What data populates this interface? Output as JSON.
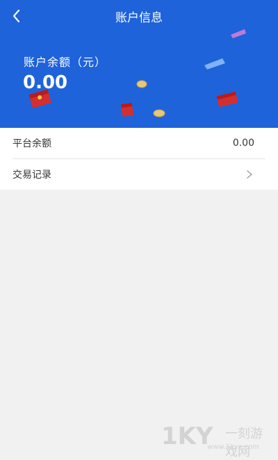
{
  "nav": {
    "title": "账户信息"
  },
  "balance": {
    "label": "账户余额（元）",
    "value": "0.00"
  },
  "list": [
    {
      "label": "平台余额",
      "value": "0.00"
    },
    {
      "label": "交易记录"
    }
  ],
  "watermark": {
    "mark": "1KY",
    "sub": "一刻游戏网",
    "url": "www.1kyx.com"
  },
  "colors": {
    "header_bg": "#1f63db",
    "page_bg": "#f1f1f1",
    "accent_red": "#d32f2f"
  }
}
